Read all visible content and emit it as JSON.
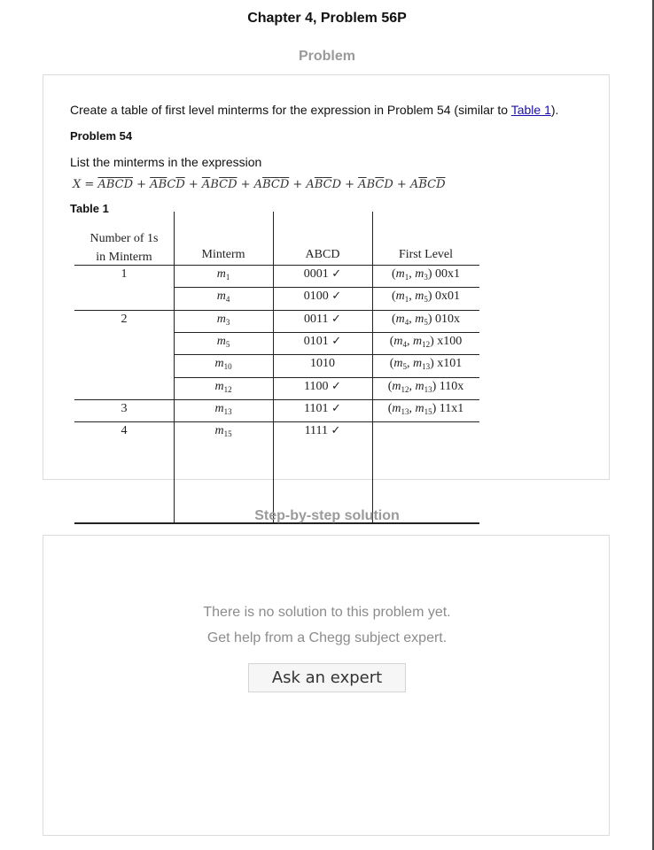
{
  "page_title": "Chapter 4, Problem 56P",
  "problem_heading": "Problem",
  "problem": {
    "intro_before_link": "Create a table of first level minterms for the expression in Problem 54 (similar to ",
    "link_text": "Table 1",
    "intro_after_link": ").",
    "subheading": "Problem 54",
    "list_text": "List the minterms in the expression",
    "expression": {
      "lhs": "X = ",
      "terms": [
        "ABCD",
        "ABCD",
        "ABCD",
        "ABCD",
        "ABCD",
        "ABCD",
        "ABCD"
      ],
      "separator": " + "
    },
    "table_label": "Table 1"
  },
  "table": {
    "headers": {
      "count_line1": "Number of 1s",
      "count_line2": "in Minterm",
      "minterm": "Minterm",
      "abcd": "ABCD",
      "first_level": "First Level"
    },
    "rows": [
      {
        "count": "1",
        "minterm": "m",
        "sub": "1",
        "abcd": "0001",
        "check": "✓",
        "fl_a": "m",
        "fl_a_sub": "1",
        "fl_b": "m",
        "fl_b_sub": "3",
        "fl_val": "00x1"
      },
      {
        "count": "",
        "minterm": "m",
        "sub": "4",
        "abcd": "0100",
        "check": "✓",
        "fl_a": "m",
        "fl_a_sub": "1",
        "fl_b": "m",
        "fl_b_sub": "5",
        "fl_val": "0x01"
      },
      {
        "count": "2",
        "minterm": "m",
        "sub": "3",
        "abcd": "0011",
        "check": "✓",
        "fl_a": "m",
        "fl_a_sub": "4",
        "fl_b": "m",
        "fl_b_sub": "5",
        "fl_val": "010x"
      },
      {
        "count": "",
        "minterm": "m",
        "sub": "5",
        "abcd": "0101",
        "check": "✓",
        "fl_a": "m",
        "fl_a_sub": "4",
        "fl_b": "m",
        "fl_b_sub": "12",
        "fl_val": "x100"
      },
      {
        "count": "",
        "minterm": "m",
        "sub": "10",
        "abcd": "1010",
        "check": "",
        "fl_a": "m",
        "fl_a_sub": "5",
        "fl_b": "m",
        "fl_b_sub": "13",
        "fl_val": "x101"
      },
      {
        "count": "",
        "minterm": "m",
        "sub": "12",
        "abcd": "1100",
        "check": "✓",
        "fl_a": "m",
        "fl_a_sub": "12",
        "fl_b": "m",
        "fl_b_sub": "13",
        "fl_val": "110x"
      },
      {
        "count": "3",
        "minterm": "m",
        "sub": "13",
        "abcd": "1101",
        "check": "✓",
        "fl_a": "m",
        "fl_a_sub": "13",
        "fl_b": "m",
        "fl_b_sub": "15",
        "fl_val": "11x1"
      },
      {
        "count": "4",
        "minterm": "m",
        "sub": "15",
        "abcd": "1111",
        "check": "✓",
        "fl_a": "",
        "fl_a_sub": "",
        "fl_b": "",
        "fl_b_sub": "",
        "fl_val": ""
      }
    ]
  },
  "solution_heading": "Step-by-step solution",
  "solution": {
    "empty_line1": "There is no solution to this problem yet.",
    "empty_line2": "Get help from a Chegg subject expert.",
    "button_label": "Ask an expert"
  }
}
